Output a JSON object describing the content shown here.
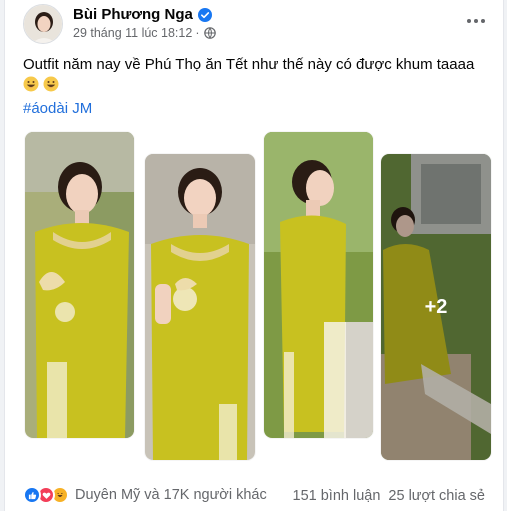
{
  "post": {
    "author": "Bùi Phương Nga",
    "timestamp": "29 tháng 11 lúc 18:12",
    "separator": "·",
    "caption": "Outfit năm nay về Phú Thọ ăn Tết như thế này có được khum taaaa",
    "hashtag": "#áodài JM"
  },
  "photos": {
    "more_count": "+2",
    "dress_color": "#c8c120",
    "count": 4
  },
  "footer": {
    "reactions_text": "Duyên Mỹ và 17K người khác",
    "comments": "151 bình luận",
    "shares": "25 lượt chia sẻ"
  },
  "icons": [
    "verified-badge-icon",
    "globe-icon",
    "more-options-icon",
    "grinning-emoji-icon",
    "like-reaction-icon",
    "love-reaction-icon",
    "haha-reaction-icon"
  ],
  "colors": {
    "link": "#216fdb",
    "muted": "#65676b",
    "like": "#1877f2",
    "love": "#f33e58",
    "haha": "#f7b125"
  }
}
